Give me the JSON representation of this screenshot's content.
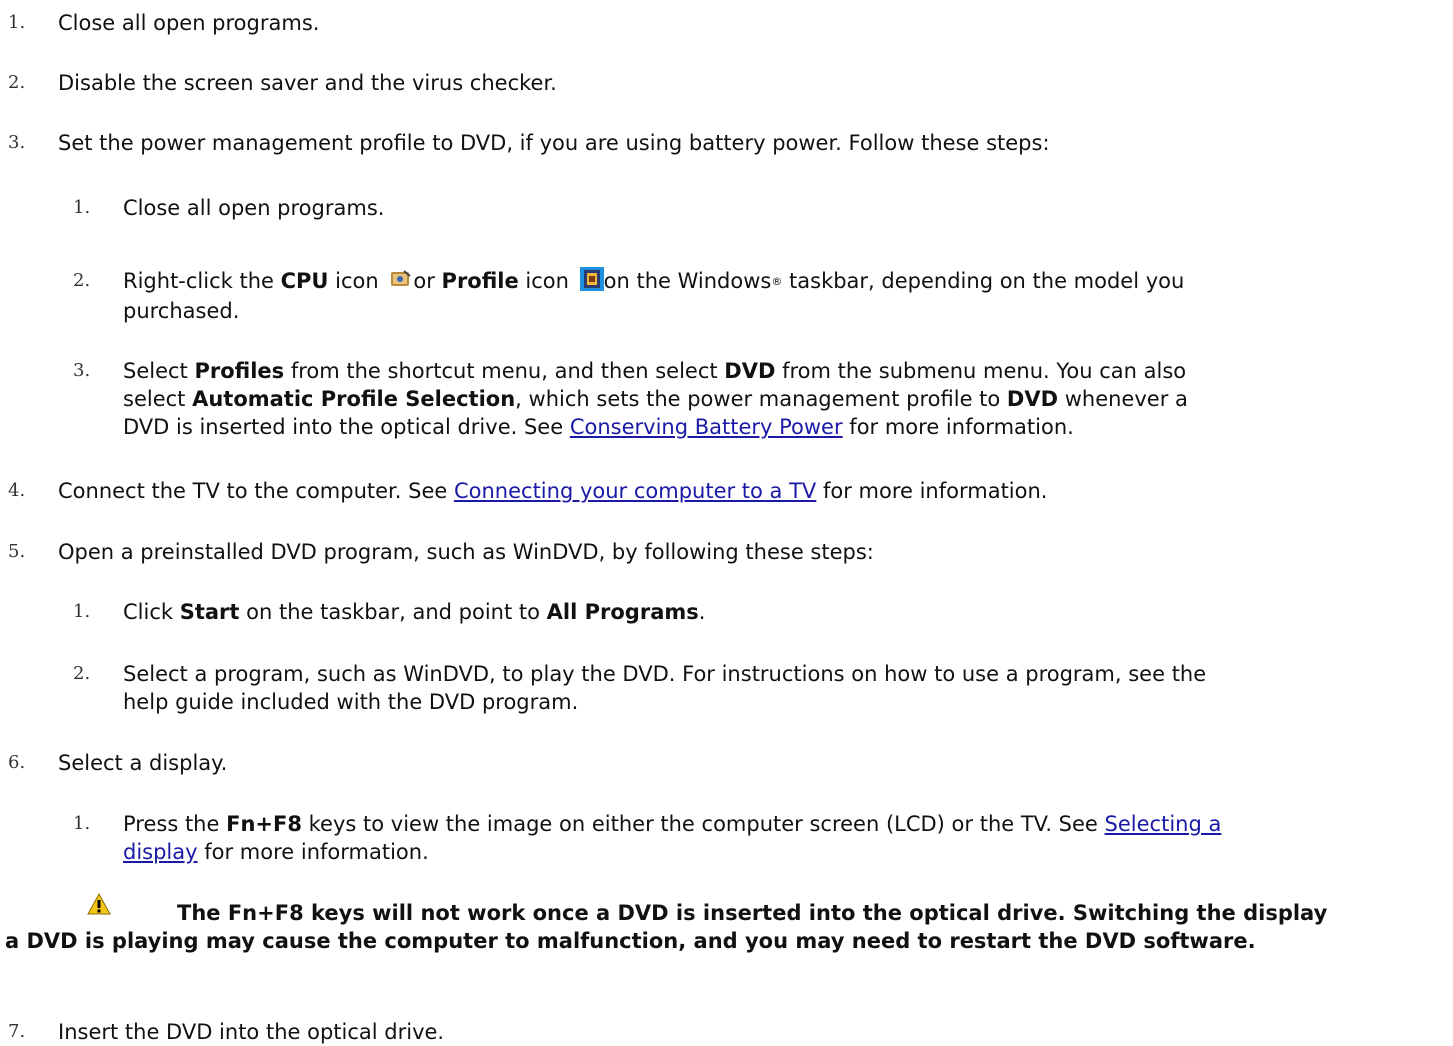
{
  "steps": [
    {
      "num": "1.",
      "text": "Close all open programs."
    },
    {
      "num": "2.",
      "text": "Disable the screen saver and the virus checker."
    },
    {
      "num": "3.",
      "text": "Set the power management profile to DVD, if you are using battery power. Follow these steps:"
    },
    {
      "num": "4.",
      "pre": "Connect the TV to the computer. See ",
      "link": "Connecting your computer to a TV",
      "post": " for more information."
    },
    {
      "num": "5.",
      "text": "Open a preinstalled DVD program, such as WinDVD, by following these steps:"
    },
    {
      "num": "6.",
      "text": "Select a display."
    },
    {
      "num": "7.",
      "text": "Insert the DVD into the optical drive."
    }
  ],
  "sub3": {
    "s1": {
      "num": "1.",
      "text": "Close all open programs."
    },
    "s2": {
      "num": "2.",
      "t1": "Right-click the ",
      "b1": "CPU",
      "t2": " icon ",
      "t3": "or ",
      "b2": "Profile",
      "t4": " icon ",
      "t5": "on the Windows",
      "reg": "®",
      "t6": " taskbar, depending on the model you",
      "l2": "purchased."
    },
    "s3": {
      "num": "3.",
      "t1": "Select ",
      "b1": "Profiles",
      "t2": " from the shortcut menu, and then select ",
      "b2": "DVD",
      "t3": " from the submenu menu. You can also",
      "l2a": "select ",
      "l2b": "Automatic Profile Selection",
      "l2c": ", which sets the power management profile to ",
      "l2d": "DVD",
      "l2e": " whenever a",
      "l3a": "DVD is inserted into the optical drive. See ",
      "link": "Conserving Battery Power",
      "l3b": " for more information."
    }
  },
  "sub5": {
    "s1": {
      "num": "1.",
      "t1": "Click ",
      "b1": "Start",
      "t2": " on the taskbar, and point to ",
      "b2": "All Programs",
      "t3": "."
    },
    "s2": {
      "num": "2.",
      "l1": "Select a program, such as WinDVD, to play the DVD. For instructions on how to use a program, see the",
      "l2": "help guide included with the DVD program."
    }
  },
  "sub6": {
    "s1": {
      "num": "1.",
      "t1": "Press the ",
      "b1": "Fn+F8",
      "t2": " keys to view the image on either the computer screen (LCD) or the TV. See ",
      "link1": "Selecting a",
      "link2": "display",
      "t3": " for more information."
    }
  },
  "warning": {
    "l1": "The Fn+F8 keys will not work once a DVD is inserted into the optical drive. Switching the display",
    "l2": "a DVD is playing may cause the computer to malfunction, and you may need to restart the DVD software."
  },
  "icons": [
    "cpu-icon",
    "profile-icon",
    "warning-icon"
  ]
}
